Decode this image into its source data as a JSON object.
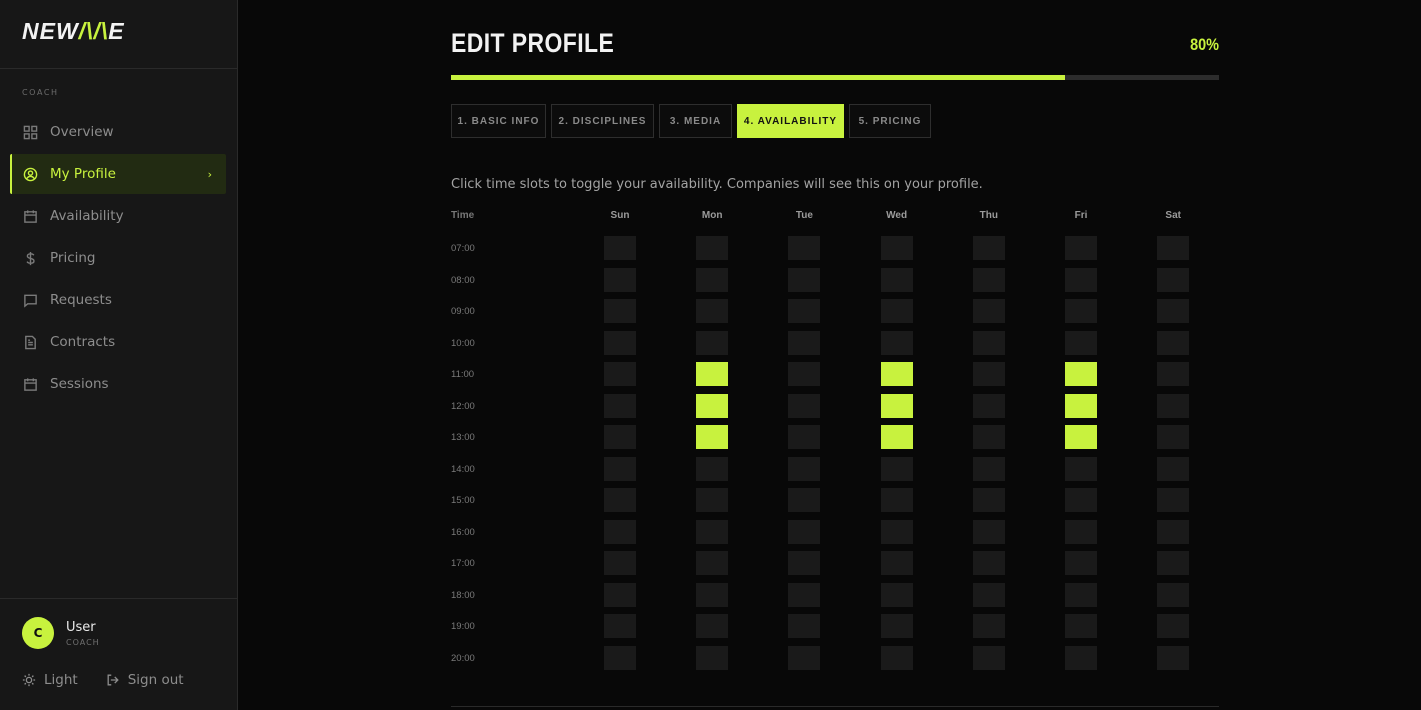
{
  "brand": {
    "logo_left": "NEW",
    "logo_mid": "/\\/\\",
    "logo_right": "E",
    "accent": "#c8f23e"
  },
  "sidebar": {
    "section": "COACH",
    "items": [
      {
        "label": "Overview",
        "icon": "grid-icon"
      },
      {
        "label": "My Profile",
        "icon": "user-circle-icon",
        "active": true
      },
      {
        "label": "Availability",
        "icon": "calendar-icon"
      },
      {
        "label": "Pricing",
        "icon": "dollar-icon"
      },
      {
        "label": "Requests",
        "icon": "message-icon"
      },
      {
        "label": "Contracts",
        "icon": "document-icon"
      },
      {
        "label": "Sessions",
        "icon": "calendar-icon"
      }
    ],
    "user": {
      "initial": "C",
      "name": "User",
      "role": "COACH"
    },
    "theme_label": "Light",
    "signout_label": "Sign out"
  },
  "page": {
    "title": "EDIT PROFILE",
    "progress_label": "80%",
    "progress_value": 0.8,
    "tabs": [
      {
        "label": "1. BASIC INFO"
      },
      {
        "label": "2. DISCIPLINES"
      },
      {
        "label": "3. MEDIA"
      },
      {
        "label": "4. AVAILABILITY",
        "active": true
      },
      {
        "label": "5. PRICING"
      }
    ],
    "hint": "Click time slots to toggle your availability. Companies will see this on your profile."
  },
  "availability": {
    "time_header": "Time",
    "days": [
      "Sun",
      "Mon",
      "Tue",
      "Wed",
      "Thu",
      "Fri",
      "Sat"
    ],
    "times": [
      "07:00",
      "08:00",
      "09:00",
      "10:00",
      "11:00",
      "12:00",
      "13:00",
      "14:00",
      "15:00",
      "16:00",
      "17:00",
      "18:00",
      "19:00",
      "20:00"
    ],
    "selected": {
      "Mon": [
        "11:00",
        "12:00",
        "13:00"
      ],
      "Wed": [
        "11:00",
        "12:00",
        "13:00"
      ],
      "Fri": [
        "11:00",
        "12:00",
        "13:00"
      ]
    }
  }
}
